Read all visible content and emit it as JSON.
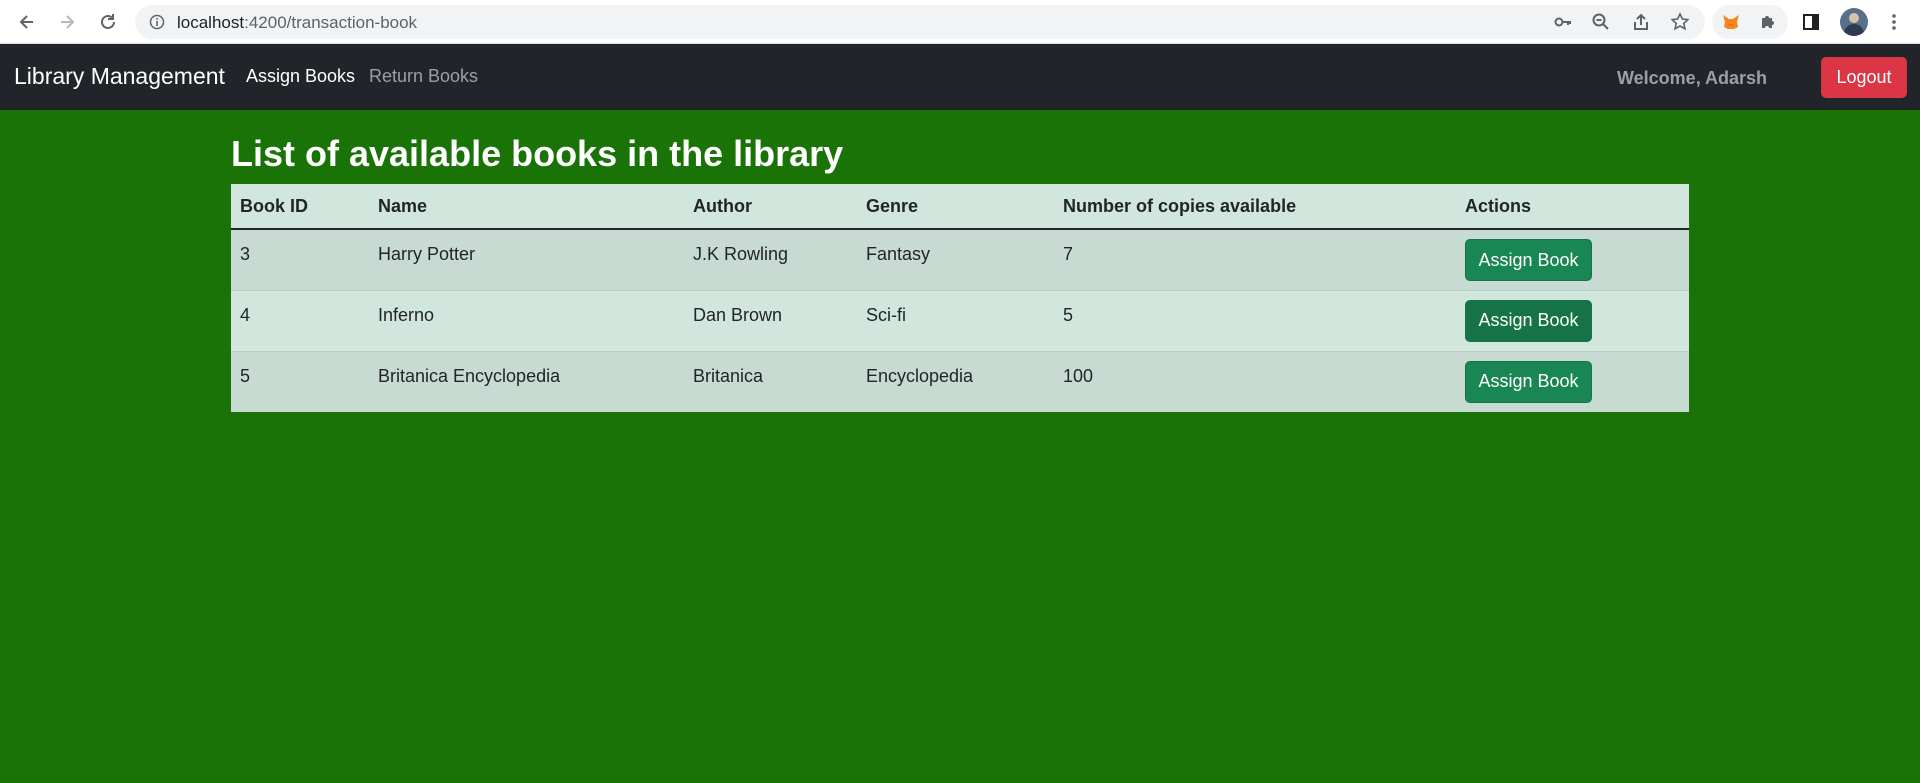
{
  "browser": {
    "url_host": "localhost",
    "url_path": ":4200/transaction-book"
  },
  "navbar": {
    "brand": "Library Management",
    "links": [
      {
        "label": "Assign Books",
        "active": true
      },
      {
        "label": "Return Books",
        "active": false
      }
    ],
    "welcome": "Welcome, Adarsh",
    "logout_label": "Logout"
  },
  "main": {
    "title": "List of available books in the library",
    "table": {
      "headers": [
        "Book ID",
        "Name",
        "Author",
        "Genre",
        "Number of copies available",
        "Actions"
      ],
      "rows": [
        {
          "id": "3",
          "name": "Harry Potter",
          "author": "J.K Rowling",
          "genre": "Fantasy",
          "copies": "7",
          "action": "Assign Book"
        },
        {
          "id": "4",
          "name": "Inferno",
          "author": "Dan Brown",
          "genre": "Sci-fi",
          "copies": "5",
          "action": "Assign Book"
        },
        {
          "id": "5",
          "name": "Britanica Encyclopedia",
          "author": "Britanica",
          "genre": "Encyclopedia",
          "copies": "100",
          "action": "Assign Book"
        }
      ]
    }
  },
  "colors": {
    "page_bg": "#1a7306",
    "navbar_bg": "#212529",
    "logout_bg": "#dc3545",
    "assign_bg": "#198754",
    "table_header_bg": "#d1e7dd"
  }
}
